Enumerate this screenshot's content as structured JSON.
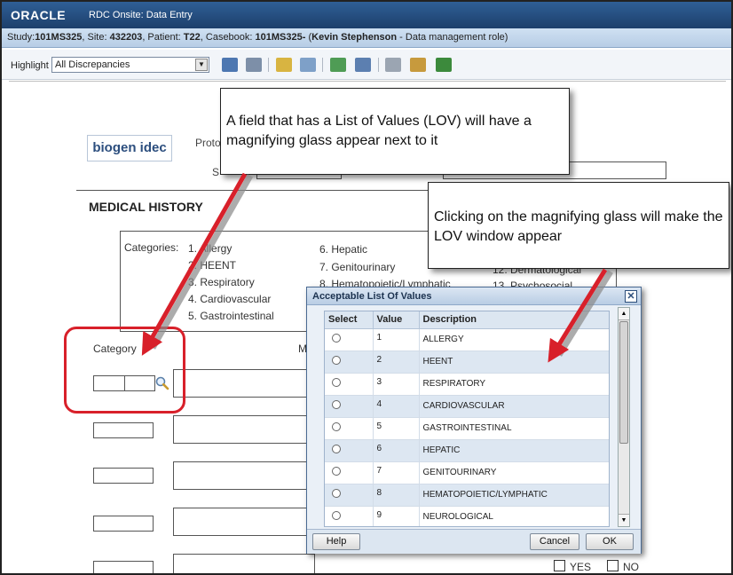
{
  "window": {
    "brand": "ORACLE",
    "title": "RDC Onsite: Data Entry"
  },
  "infobar": {
    "study_label": "Study:",
    "study": "101MS325",
    "site_label": ", Site: ",
    "site": "432203",
    "patient_label": ", Patient: ",
    "patient": "T22",
    "casebook_label": ", Casebook: ",
    "casebook": "101MS325-",
    "user": "Kevin Stephenson",
    "role": " - Data management role)"
  },
  "toolbar": {
    "highlight_label": "Highlight",
    "highlight_value": "All Discrepancies"
  },
  "form": {
    "logo_text": "biogen idec",
    "proto_label": "Proto",
    "s_label": "S",
    "section_title": "MEDICAL HISTORY",
    "categories_label": "Categories:",
    "categories_col1": [
      "1. Allergy",
      "2. HEENT",
      "3. Respiratory",
      "4. Cardiovascular",
      "5. Gastrointestinal"
    ],
    "categories_col2": [
      "6. Hepatic",
      "7. Genitourinary",
      "8. Hematopoietic/Lymphatic"
    ],
    "categories_col3": [
      "12. Dermatological",
      "13. Psychosocial"
    ],
    "category_column_label": "Category",
    "m_label": "M",
    "yes_label": "YES",
    "no_label": "NO"
  },
  "callouts": {
    "lov_field": "A field that has a List of Values (LOV) will have a magnifying glass appear next to it",
    "lov_window": "Clicking on the magnifying glass will make the LOV window appear"
  },
  "lov": {
    "title": "Acceptable List Of Values",
    "headers": {
      "select": "Select",
      "value": "Value",
      "description": "Description"
    },
    "rows": [
      {
        "value": "1",
        "description": "ALLERGY"
      },
      {
        "value": "2",
        "description": "HEENT"
      },
      {
        "value": "3",
        "description": "RESPIRATORY"
      },
      {
        "value": "4",
        "description": "CARDIOVASCULAR"
      },
      {
        "value": "5",
        "description": "GASTROINTESTINAL"
      },
      {
        "value": "6",
        "description": "HEPATIC"
      },
      {
        "value": "7",
        "description": "GENITOURINARY"
      },
      {
        "value": "8",
        "description": "HEMATOPOIETIC/LYMPHATIC"
      },
      {
        "value": "9",
        "description": "NEUROLOGICAL"
      }
    ],
    "help_label": "Help",
    "cancel_label": "Cancel",
    "ok_label": "OK"
  },
  "colors": {
    "titlebar": "#1d3f6b",
    "annotation_red": "#d8202a"
  }
}
